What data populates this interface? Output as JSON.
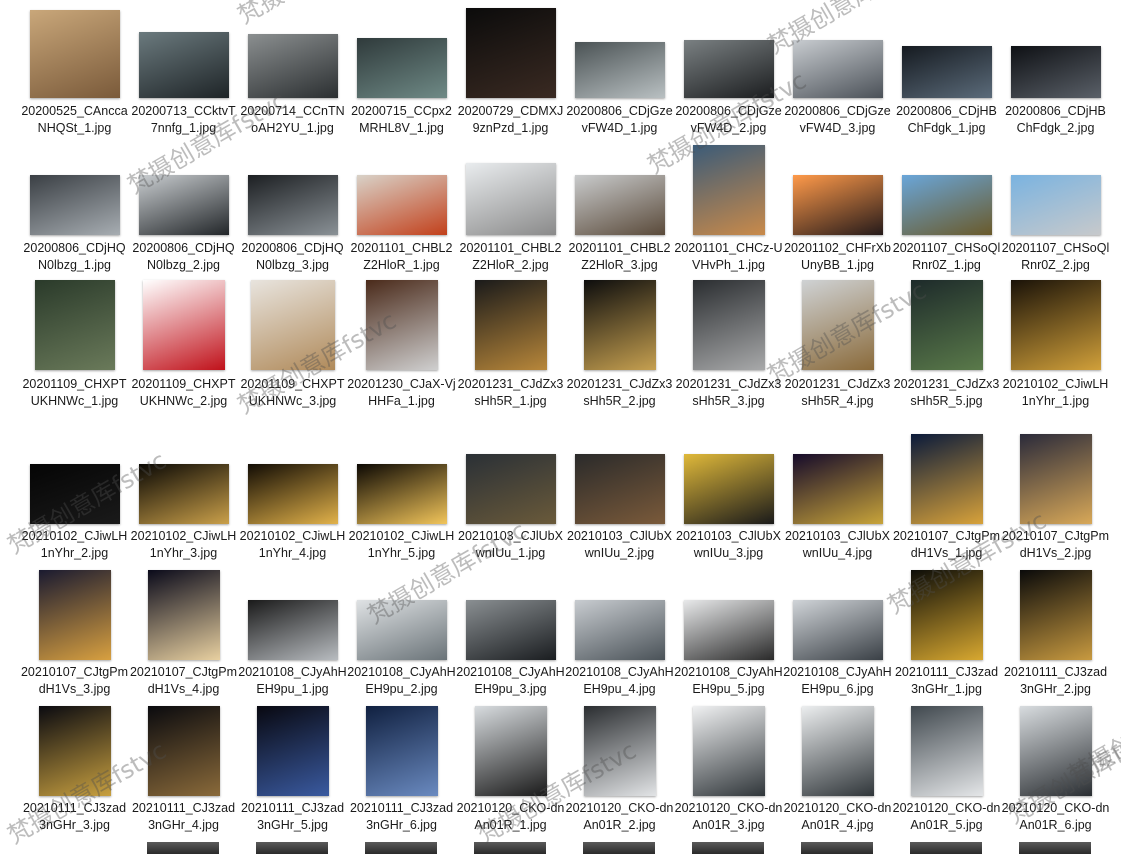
{
  "watermark_text": "梵摄创意库fstvc",
  "files": [
    [
      "20200525_CAnccaNHQSt_1.jpg",
      "20200713_CCktvT7nnfg_1.jpg",
      "20200714_CCnTNoAH2YU_1.jpg",
      "20200715_CCpx2MRHL8V_1.jpg",
      "20200729_CDMXJ9znPzd_1.jpg",
      "20200806_CDjGzevFW4D_1.jpg",
      "20200806_CDjGzevFW4D_2.jpg",
      "20200806_CDjGzevFW4D_3.jpg",
      "20200806_CDjHBChFdgk_1.jpg",
      "20200806_CDjHBChFdgk_2.jpg"
    ],
    [
      "20200806_CDjHQN0lbzg_1.jpg",
      "20200806_CDjHQN0lbzg_2.jpg",
      "20200806_CDjHQN0lbzg_3.jpg",
      "20201101_CHBL2Z2HloR_1.jpg",
      "20201101_CHBL2Z2HloR_2.jpg",
      "20201101_CHBL2Z2HloR_3.jpg",
      "20201101_CHCz-UVHvPh_1.jpg",
      "20201102_CHFrXbUnyBB_1.jpg",
      "20201107_CHSoQlRnr0Z_1.jpg",
      "20201107_CHSoQlRnr0Z_2.jpg"
    ],
    [
      "20201109_CHXPTUKHNWc_1.jpg",
      "20201109_CHXPTUKHNWc_2.jpg",
      "20201109_CHXPTUKHNWc_3.jpg",
      "20201230_CJaX-VjHHFa_1.jpg",
      "20201231_CJdZx3sHh5R_1.jpg",
      "20201231_CJdZx3sHh5R_2.jpg",
      "20201231_CJdZx3sHh5R_3.jpg",
      "20201231_CJdZx3sHh5R_4.jpg",
      "20201231_CJdZx3sHh5R_5.jpg",
      "20210102_CJiwLH1nYhr_1.jpg"
    ],
    [
      "20210102_CJiwLH1nYhr_2.jpg",
      "20210102_CJiwLH1nYhr_3.jpg",
      "20210102_CJiwLH1nYhr_4.jpg",
      "20210102_CJiwLH1nYhr_5.jpg",
      "20210103_CJlUbXwnIUu_1.jpg",
      "20210103_CJlUbXwnIUu_2.jpg",
      "20210103_CJlUbXwnIUu_3.jpg",
      "20210103_CJlUbXwnIUu_4.jpg",
      "20210107_CJtgPmdH1Vs_1.jpg",
      "20210107_CJtgPmdH1Vs_2.jpg"
    ],
    [
      "20210107_CJtgPmdH1Vs_3.jpg",
      "20210107_CJtgPmdH1Vs_4.jpg",
      "20210108_CJyAhHEH9pu_1.jpg",
      "20210108_CJyAhHEH9pu_2.jpg",
      "20210108_CJyAhHEH9pu_3.jpg",
      "20210108_CJyAhHEH9pu_4.jpg",
      "20210108_CJyAhHEH9pu_5.jpg",
      "20210108_CJyAhHEH9pu_6.jpg",
      "20210111_CJ3zad3nGHr_1.jpg",
      "20210111_CJ3zad3nGHr_2.jpg"
    ],
    [
      "20210111_CJ3zad3nGHr_3.jpg",
      "20210111_CJ3zad3nGHr_4.jpg",
      "20210111_CJ3zad3nGHr_5.jpg",
      "20210111_CJ3zad3nGHr_6.jpg",
      "20210120_CKO-dnAn01R_1.jpg",
      "20210120_CKO-dnAn01R_2.jpg",
      "20210120_CKO-dnAn01R_3.jpg",
      "20210120_CKO-dnAn01R_4.jpg",
      "20210120_CKO-dnAn01R_5.jpg",
      "20210120_CKO-dnAn01R_6.jpg"
    ]
  ]
}
